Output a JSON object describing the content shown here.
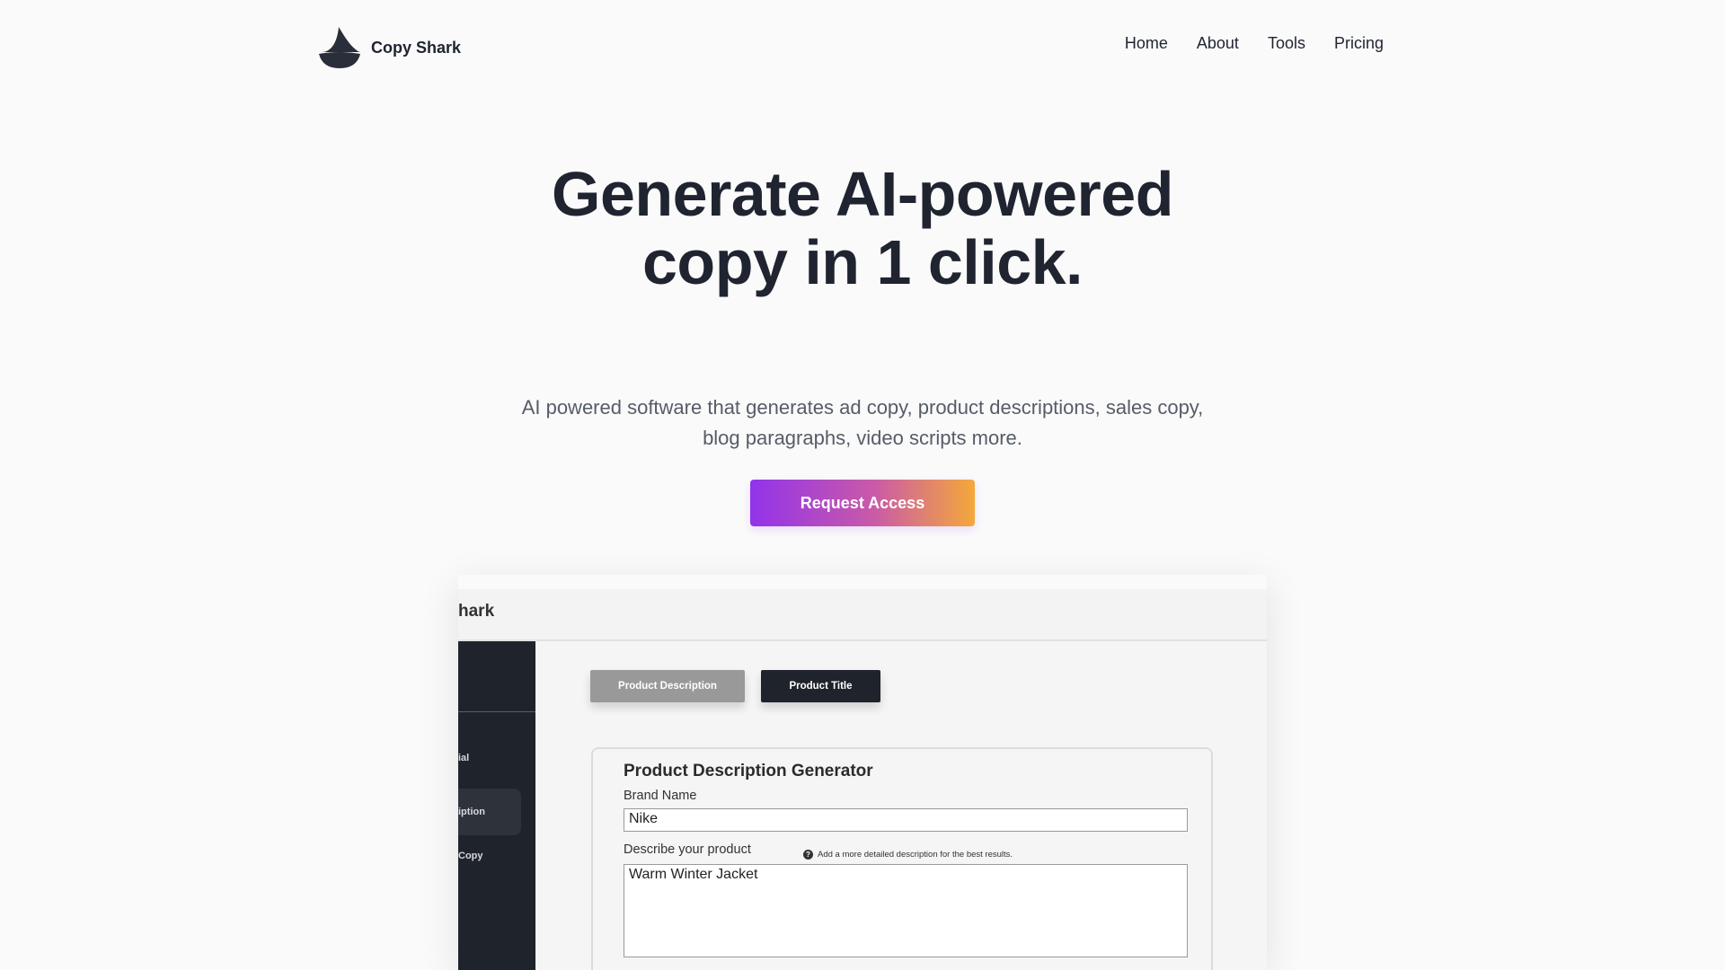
{
  "header": {
    "brand_name": "Copy Shark",
    "nav": [
      {
        "label": "Home"
      },
      {
        "label": "About"
      },
      {
        "label": "Tools"
      },
      {
        "label": "Pricing"
      }
    ]
  },
  "hero": {
    "title": "Generate AI-powered copy in 1 click.",
    "subtitle": "AI powered software that generates ad copy, product descriptions, sales copy, blog paragraphs, video scripts more.",
    "cta_label": "Request Access"
  },
  "preview": {
    "brand_fragment": "hark",
    "sidebar_items": [
      {
        "label": "ial"
      },
      {
        "label": "iption"
      },
      {
        "label": "Copy"
      }
    ],
    "tabs": [
      {
        "label": "Product Description"
      },
      {
        "label": "Product Title"
      }
    ],
    "card": {
      "title": "Product Description Generator",
      "brand_label": "Brand Name",
      "brand_value": "Nike",
      "describe_label": "Describe your product",
      "hint": "Add a more detailed description for the best results.",
      "describe_value": "Warm Winter Jacket"
    }
  },
  "colors": {
    "background": "#fafafa",
    "text": "#1f2430",
    "cta_gradient_start": "#9233ea",
    "cta_gradient_end": "#f5a83a",
    "sidebar": "#1f232b"
  }
}
